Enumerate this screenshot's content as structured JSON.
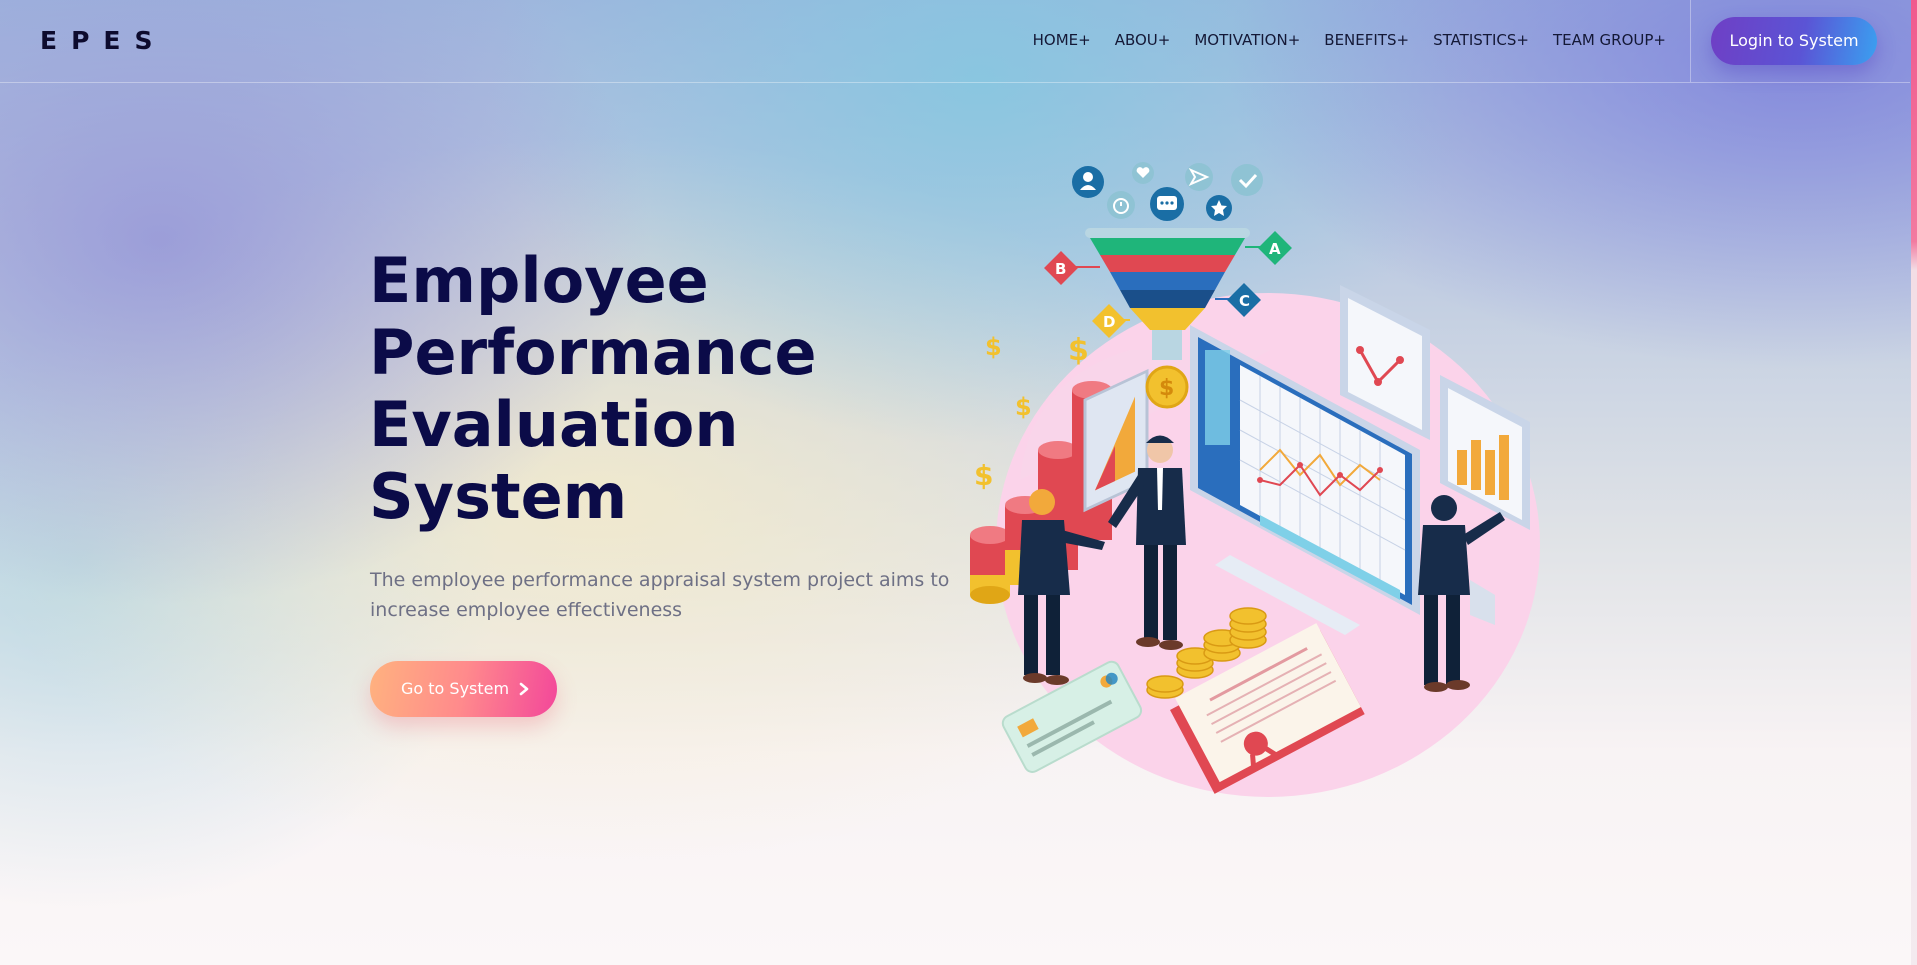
{
  "header": {
    "logo": "EPES",
    "nav": [
      {
        "label": "HOME+"
      },
      {
        "label": "ABOU+"
      },
      {
        "label": "MOTIVATION+"
      },
      {
        "label": "BENEFITS+"
      },
      {
        "label": "STATISTICS+"
      },
      {
        "label": "TEAM GROUP+"
      }
    ],
    "login_button": "Login to System"
  },
  "hero": {
    "title": "Employee Performance Evaluation System",
    "subtitle": "The employee performance appraisal system project aims to increase employee effectiveness",
    "cta_label": "Go to System"
  },
  "illustration": {
    "funnel_labels": [
      "A",
      "B",
      "C",
      "D"
    ],
    "coin_symbol": "$",
    "icons": [
      "user-icon",
      "heart-icon",
      "send-icon",
      "check-icon",
      "timer-icon",
      "chat-icon",
      "star-icon"
    ]
  },
  "colors": {
    "title": "#0b0b48",
    "login_gradient": [
      "#6f3fc5",
      "#3aa0f0"
    ],
    "cta_gradient": [
      "#ffb27f",
      "#f3479a"
    ],
    "funnel": [
      "#1fb57a",
      "#e04852",
      "#2a6ebd",
      "#f2c12e"
    ]
  }
}
